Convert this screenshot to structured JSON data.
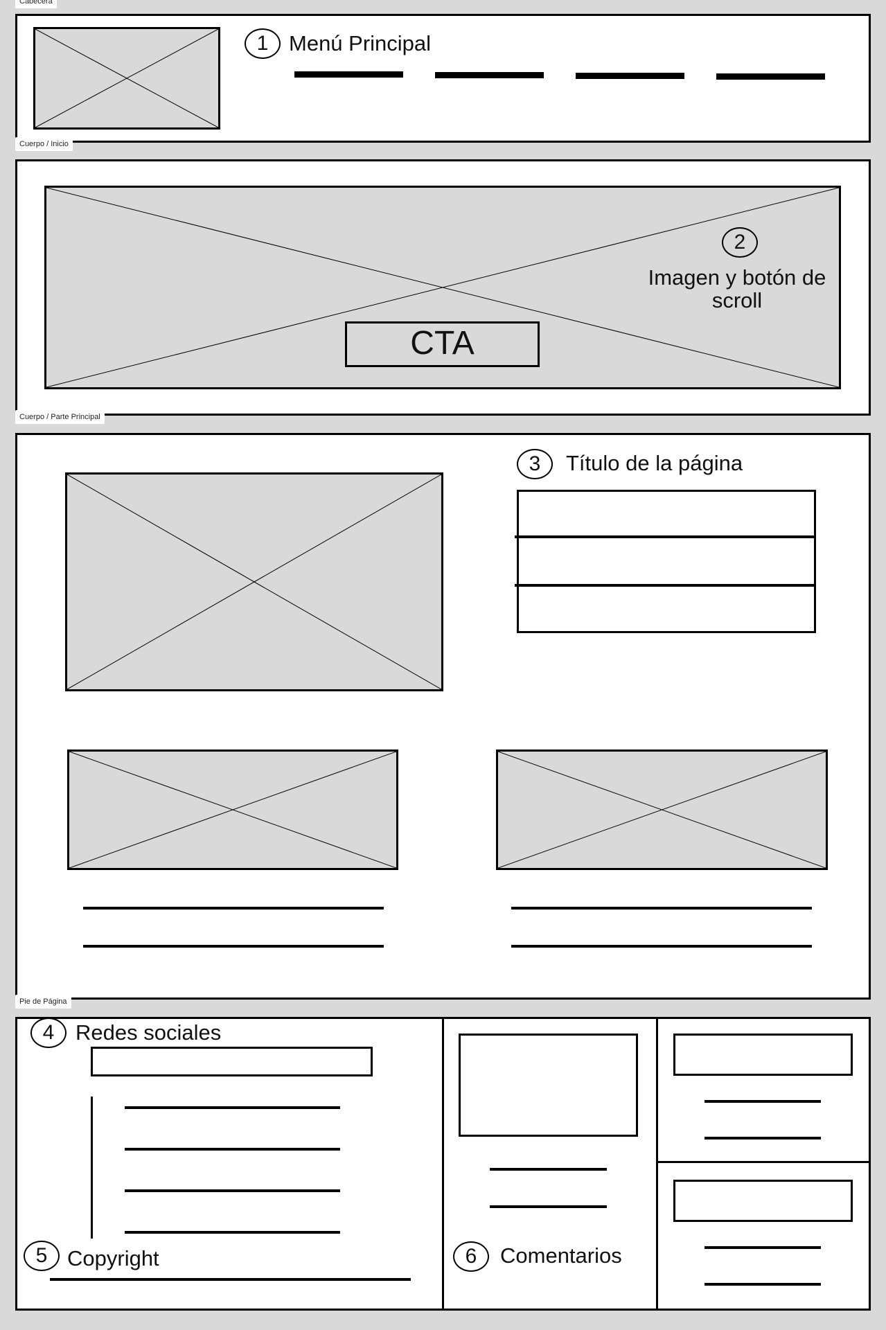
{
  "sections": {
    "header_tag": "Cabecera",
    "hero_tag": "Cuerpo / Inicio",
    "main_tag": "Cuerpo / Parte Principal",
    "footer_tag": "Pie de Página"
  },
  "header": {
    "marker": "1",
    "title": "Menú Principal"
  },
  "hero": {
    "marker": "2",
    "note": "Imagen y botón de scroll",
    "cta_label": "CTA"
  },
  "main": {
    "marker": "3",
    "title": "Título de la página"
  },
  "footer": {
    "social": {
      "marker": "4",
      "label": "Redes sociales"
    },
    "copyright": {
      "marker": "5",
      "label": "Copyright"
    },
    "comments": {
      "marker": "6",
      "label": "Comentarios"
    }
  },
  "colors": {
    "background": "#d9d9d9",
    "panel": "#ffffff",
    "stroke": "#000000",
    "placeholder_fill": "#d9d9d9"
  }
}
